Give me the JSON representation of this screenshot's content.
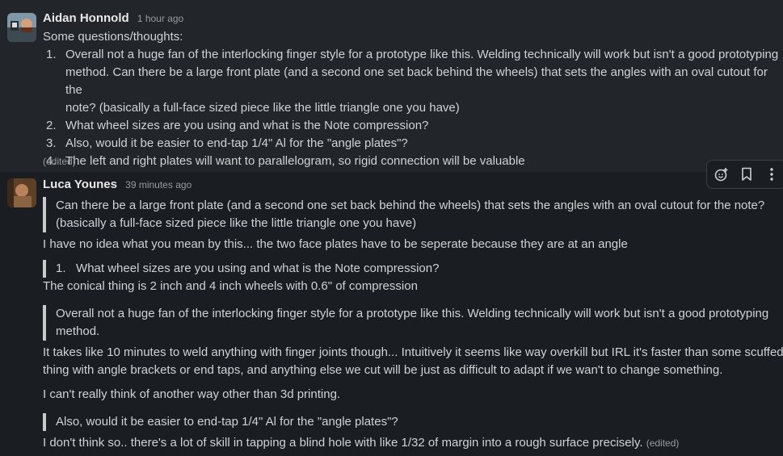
{
  "previous_message_cutoff": "y ... ...g ... ... p ... ... ...",
  "messages": [
    {
      "author": "Aidan Honnold",
      "time": "1 hour ago",
      "intro": "Some questions/thoughts:",
      "list": [
        {
          "num": "1.",
          "lines": [
            "Overall not a huge fan of the interlocking finger style for a prototype like this. Welding technically will work but isn't a good prototyping",
            "method. Can there be a large front plate (and a second one set back behind the wheels) that sets the angles with an oval cutout for the",
            "note? (basically a full-face sized piece like the little triangle one you have)"
          ]
        },
        {
          "num": "2.",
          "lines": [
            "What wheel sizes are you using and what is the Note compression?"
          ]
        },
        {
          "num": "3.",
          "lines": [
            "Also, would it be easier to end-tap 1/4\" Al for the \"angle plates\"?"
          ]
        },
        {
          "num": "4.",
          "lines": [
            "The left and right plates will want to parallelogram, so rigid connection will be valuable"
          ]
        }
      ],
      "edited": "(edited)"
    },
    {
      "author": "Luca Younes",
      "time": "39 minutes ago",
      "quote1": [
        "Can there be a large front plate (and a second one set back behind the wheels) that sets the angles with an oval cutout for the note?",
        "(basically a full-face sized piece like the little triangle one you have)"
      ],
      "reply1": "I have no idea what you mean by this... the two face plates have to be seperate because they are at an angle",
      "quote2_num": "1.",
      "quote2": "What wheel sizes are you using and what is the Note compression?",
      "reply2": "The conical thing is 2 inch and 4 inch wheels with 0.6\" of compression",
      "quote3": [
        "Overall not a huge fan of the interlocking finger style for a prototype like this. Welding technically will work but isn't a good prototyping",
        "method."
      ],
      "reply3": [
        "It takes like 10 minutes to weld anything with finger joints though... Intuitively it seems like way overkill but IRL it's faster than some scuffed",
        "thing with angle brackets or end taps, and anything else we cut will be just as difficult to adapt if we wan't to change something."
      ],
      "reply4": "I can't really think of another way other than 3d printing.",
      "quote4": "Also, would it be easier to end-tap 1/4\" Al for the \"angle plates\"?",
      "reply5": "I don't think so.. there's a lot of skill in tapping a blind hole with like 1/32 of margin into a rough surface precisely.",
      "edited": "(edited)"
    }
  ],
  "toolbar": {
    "icons": [
      "add-reaction-icon",
      "bookmark-icon",
      "more-actions-icon"
    ]
  },
  "colors": {
    "background": "#1a1d21",
    "hover_background": "#222529",
    "text": "#d1d2d3",
    "muted": "#9a9b9d",
    "quote_bar": "#c9cacc"
  }
}
